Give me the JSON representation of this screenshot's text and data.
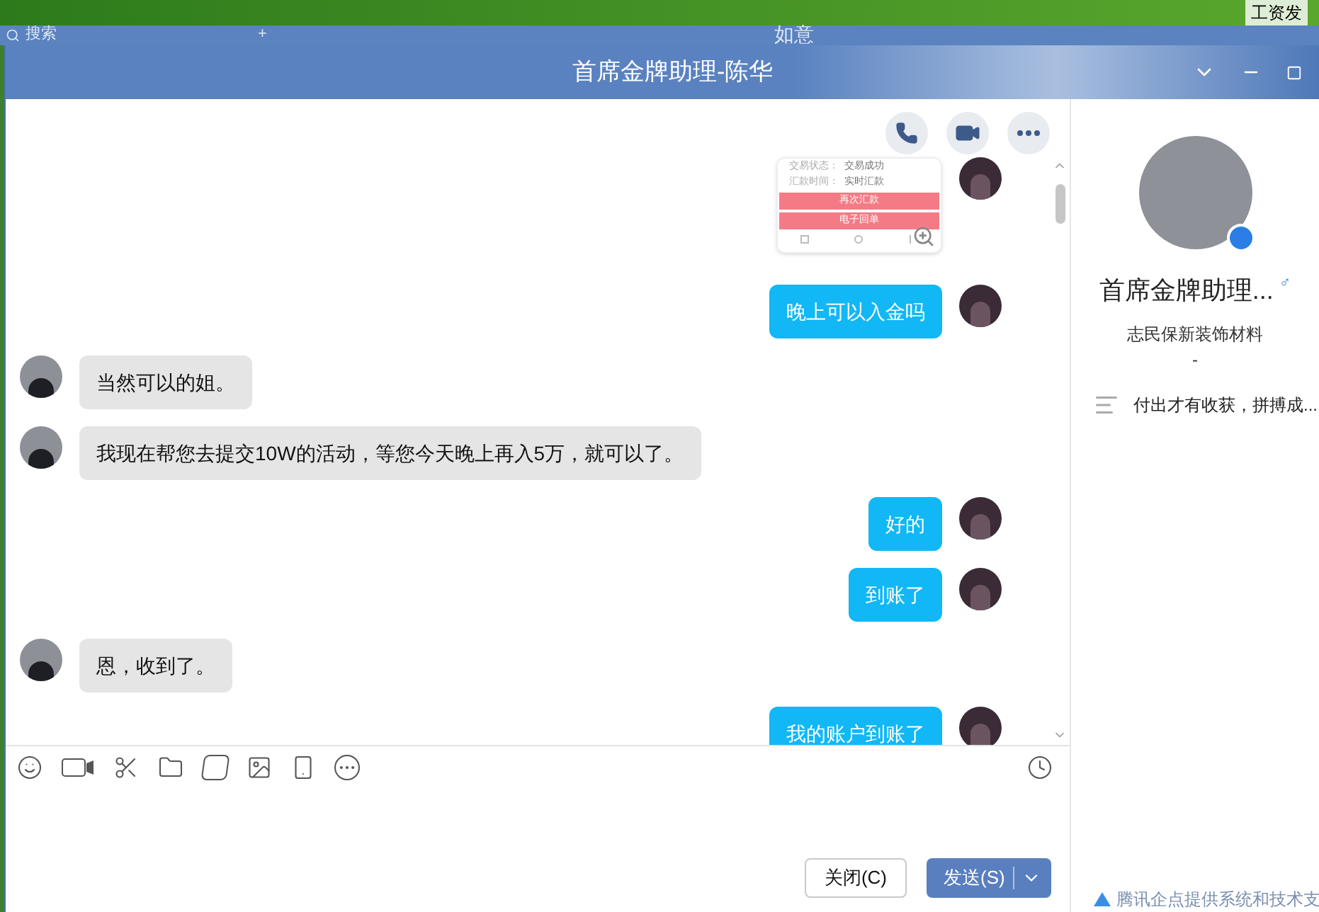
{
  "background_window": {
    "search": {
      "placeholder": "搜索"
    },
    "add_button": "+",
    "title": "如意",
    "desktop_label": "工资发"
  },
  "window": {
    "title": "首席金牌助理-陈华"
  },
  "chat": {
    "messages": [
      {
        "kind": "image",
        "from_self": true,
        "lines": [
          {
            "label": "交易状态：",
            "value": "交易成功"
          },
          {
            "label": "汇款时间：",
            "value": "实时汇款"
          }
        ],
        "buttons": [
          "再次汇款",
          "电子回单"
        ]
      },
      {
        "kind": "text",
        "from_self": true,
        "text": "晚上可以入金吗"
      },
      {
        "kind": "text",
        "from_self": false,
        "text": "当然可以的姐。"
      },
      {
        "kind": "text",
        "from_self": false,
        "text": "我现在帮您去提交10W的活动，等您今天晚上再入5万，就可以了。"
      },
      {
        "kind": "text",
        "from_self": true,
        "text": "好的"
      },
      {
        "kind": "text",
        "from_self": true,
        "text": "到账了"
      },
      {
        "kind": "text",
        "from_self": false,
        "text": "恩，收到了。"
      },
      {
        "kind": "text",
        "from_self": true,
        "text": "我的账户到账了"
      }
    ]
  },
  "buttons": {
    "close": "关闭(C)",
    "send": "发送(S)"
  },
  "profile": {
    "name": "首席金牌助理...",
    "gender_symbol": "♂",
    "company": "志民保新装饰材料",
    "dash": "-",
    "signature": "付出才有收获，拼搏成...",
    "footer": "腾讯企点提供系统和技术支"
  }
}
